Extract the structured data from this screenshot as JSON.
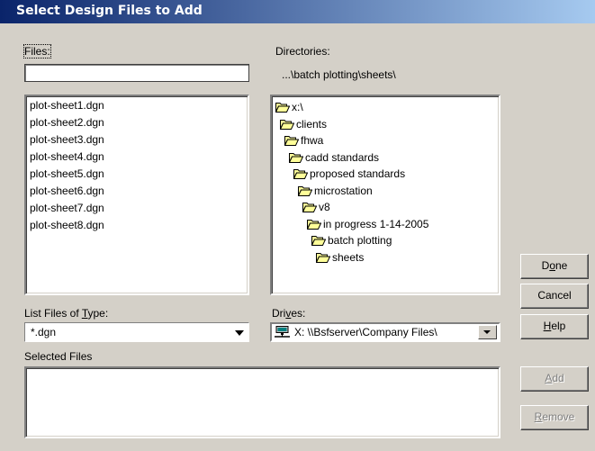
{
  "window": {
    "title": "Select Design Files to Add"
  },
  "files": {
    "label": "Files:",
    "value": "",
    "items": [
      "plot-sheet1.dgn",
      "plot-sheet2.dgn",
      "plot-sheet3.dgn",
      "plot-sheet4.dgn",
      "plot-sheet5.dgn",
      "plot-sheet6.dgn",
      "plot-sheet7.dgn",
      "plot-sheet8.dgn"
    ]
  },
  "directories": {
    "label": "Directories:",
    "current_path": "...\\batch plotting\\sheets\\",
    "tree": [
      "x:\\",
      "clients",
      "fhwa",
      "cadd standards",
      "proposed standards",
      "microstation",
      "v8",
      "in progress 1-14-2005",
      "batch plotting",
      "sheets"
    ]
  },
  "file_type": {
    "label_pre": "List Files of ",
    "label_key": "T",
    "label_post": "ype:",
    "value": "*.dgn"
  },
  "drives": {
    "label_pre": "Dri",
    "label_key": "v",
    "label_post": "es:",
    "value": "X: \\\\Bsfserver\\Company Files\\"
  },
  "selected_files": {
    "label": "Selected Files",
    "items": []
  },
  "buttons": {
    "done": {
      "pre": "D",
      "key": "o",
      "post": "ne"
    },
    "cancel": "Cancel",
    "help": {
      "key": "H",
      "post": "elp"
    },
    "add": {
      "key": "A",
      "post": "dd"
    },
    "remove": {
      "key": "R",
      "post": "emove"
    }
  },
  "colors": {
    "face": "#d4d0c8",
    "title_start": "#0a246a",
    "title_end": "#a6caf0",
    "folder": "#ffff99"
  },
  "icons": {
    "folder": "folder-icon",
    "open_folder": "open-folder-icon",
    "network_drive": "network-drive-icon"
  }
}
